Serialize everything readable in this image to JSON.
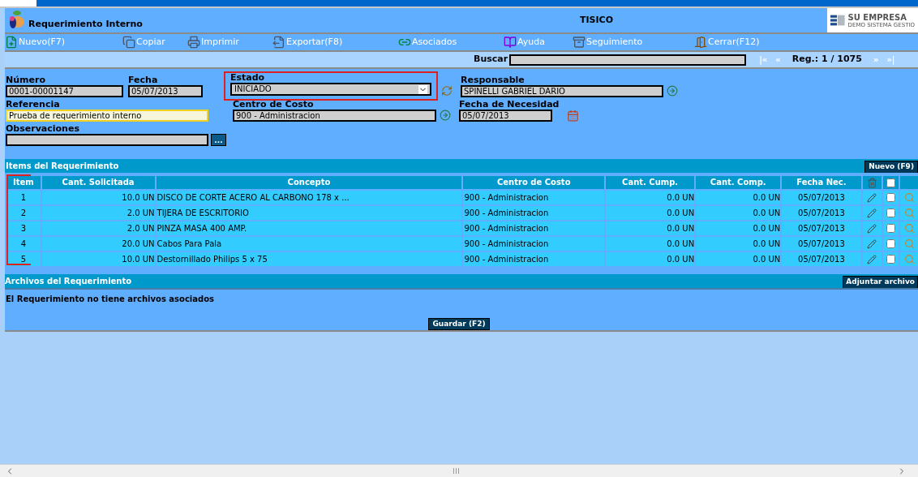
{
  "header": {
    "title": "Requerimiento Interno",
    "company_code": "TISICO",
    "logo": {
      "name": "SU EMPRESA",
      "tagline": "DEMO SISTEMA GESTIO"
    }
  },
  "toolbar": [
    {
      "label": "Nuevo(F7)"
    },
    {
      "label": "Copiar"
    },
    {
      "label": "Imprimir"
    },
    {
      "label": "Exportar(F8)"
    },
    {
      "label": "Asociados"
    },
    {
      "label": "Ayuda"
    },
    {
      "label": "Seguimiento"
    },
    {
      "label": "Cerrar(F12)"
    }
  ],
  "search": {
    "label": "Buscar",
    "first": "|«",
    "prev": "«",
    "record": "Reg.: 1 / 1075",
    "next": "»",
    "last": "»|"
  },
  "form": {
    "numero": {
      "label": "Número",
      "value": "0001-00001147"
    },
    "fecha": {
      "label": "Fecha",
      "value": "05/07/2013"
    },
    "estado": {
      "label": "Estado",
      "value": "INICIADO",
      "highlighted": true
    },
    "responsable": {
      "label": "Responsable",
      "value": "SPINELLI GABRIEL DARIO"
    },
    "referencia": {
      "label": "Referencia",
      "value": "Prueba de requerimiento interno"
    },
    "centro": {
      "label": "Centro de Costo",
      "value": "900 - Administracion"
    },
    "fecha_necesidad": {
      "label": "Fecha de Necesidad",
      "value": "05/07/2013"
    },
    "observaciones": {
      "label": "Observaciones",
      "button": "..."
    }
  },
  "items": {
    "title": "Items del Requerimiento",
    "new_button": "Nuevo (F9)",
    "item_column_highlighted": true,
    "columns": [
      "Item",
      "Cant. Solicitada",
      "Concepto",
      "Centro de Costo",
      "Cant. Cump.",
      "Cant. Comp.",
      "Fecha Nec."
    ],
    "select_all_checked": false,
    "rows": [
      {
        "cells": [
          "1",
          "10.0 UN",
          "DISCO DE CORTE ACERO AL CARBONO 178 x ...",
          "900 - Administracion",
          "0.0 UN",
          "0.0 UN",
          "05/07/2013"
        ],
        "checked": false
      },
      {
        "cells": [
          "2",
          "2.0 UN",
          "TIJERA DE ESCRITORIO",
          "900 - Administracion",
          "0.0 UN",
          "0.0 UN",
          "05/07/2013"
        ],
        "checked": false
      },
      {
        "cells": [
          "3",
          "2.0 UN",
          "PINZA MASA 400 AMP.",
          "900 - Administracion",
          "0.0 UN",
          "0.0 UN",
          "05/07/2013"
        ],
        "checked": false
      },
      {
        "cells": [
          "4",
          "20.0 UN",
          "Cabos Para Pala",
          "900 - Administracion",
          "0.0 UN",
          "0.0 UN",
          "05/07/2013"
        ],
        "checked": false
      },
      {
        "cells": [
          "5",
          "10.0 UN",
          "Destornillado Philips 5 x 75",
          "900 - Administracion",
          "0.0 UN",
          "0.0 UN",
          "05/07/2013"
        ],
        "checked": false
      }
    ]
  },
  "files": {
    "title": "Archivos del Requerimiento",
    "attach_button": "Adjuntar archivo",
    "message": "El Requerimiento no tiene archivos asociados"
  },
  "save_button": "Guardar (F2)"
}
